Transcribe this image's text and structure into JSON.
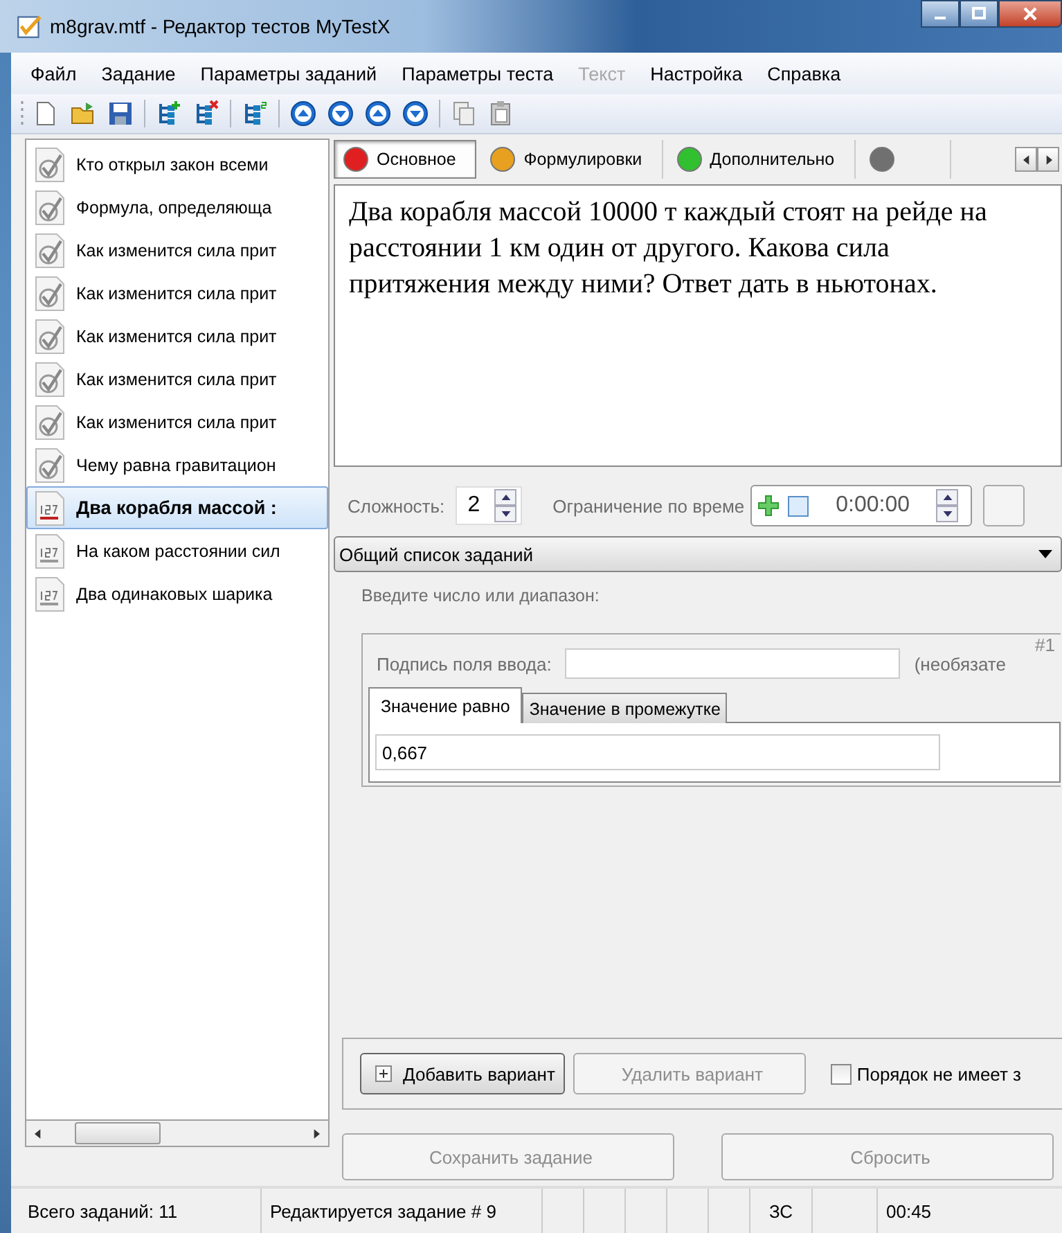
{
  "window": {
    "title": "m8grav.mtf - Редактор тестов MyTestX"
  },
  "menu": [
    {
      "label": "Файл",
      "disabled": false
    },
    {
      "label": "Задание",
      "disabled": false
    },
    {
      "label": "Параметры заданий",
      "disabled": false
    },
    {
      "label": "Параметры теста",
      "disabled": false
    },
    {
      "label": "Текст",
      "disabled": true
    },
    {
      "label": "Настройка",
      "disabled": false
    },
    {
      "label": "Справка",
      "disabled": false
    }
  ],
  "sidebar": {
    "items": [
      {
        "text": "Кто открыл закон всеми",
        "kind": "choice",
        "selected": false
      },
      {
        "text": "Формула, определяюща",
        "kind": "choice",
        "selected": false
      },
      {
        "text": "Как изменится сила прит",
        "kind": "choice",
        "selected": false
      },
      {
        "text": "Как изменится сила прит",
        "kind": "choice",
        "selected": false
      },
      {
        "text": "Как изменится сила прит",
        "kind": "choice",
        "selected": false
      },
      {
        "text": "Как изменится сила прит",
        "kind": "choice",
        "selected": false
      },
      {
        "text": "Как изменится сила прит",
        "kind": "choice",
        "selected": false
      },
      {
        "text": "Чему равна гравитацион",
        "kind": "choice",
        "selected": false
      },
      {
        "text": "Два корабля массой :",
        "kind": "number",
        "selected": true
      },
      {
        "text": "На каком расстоянии сил",
        "kind": "number",
        "selected": false
      },
      {
        "text": "Два одинаковых шарика",
        "kind": "number",
        "selected": false
      }
    ]
  },
  "tabs": [
    {
      "label": "Основное",
      "color": "#e02020",
      "selected": true
    },
    {
      "label": "Формулировки",
      "color": "#e8a020",
      "selected": false
    },
    {
      "label": "Дополнительно",
      "color": "#30c030",
      "selected": false
    },
    {
      "color": "#707070",
      "selected": false
    }
  ],
  "question": "Два корабля массой 10000 т каждый стоят на рейде на расстоянии 1 км один от другого. Какова сила притяжения между ними? Ответ дать в ньютонах.",
  "difficulty": {
    "label": "Сложность:",
    "value": "2"
  },
  "time_limit": {
    "label": "Ограничение по време",
    "checked": false,
    "value": "0:00:00"
  },
  "task_list": {
    "value": "Общий список заданий"
  },
  "prompt": "Введите число или диапазон:",
  "variant": {
    "index": "#1",
    "caption_label": "Подпись поля ввода:",
    "caption_note": "(необязате",
    "answer_tabs": [
      {
        "label": "Значение равно",
        "selected": true
      },
      {
        "label": "Значение в промежутке",
        "selected": false
      }
    ],
    "answer": "0,667"
  },
  "add_button": {
    "label": "Добавить вариант",
    "disabled": false
  },
  "delete_button": {
    "label": "Удалить вариант",
    "disabled": true
  },
  "order_checkbox": {
    "label": "Порядок не имеет з",
    "checked": false
  },
  "save_button": {
    "label": "Сохранить задание",
    "disabled": true
  },
  "reset_button": {
    "label": "Сбросить",
    "disabled": true
  },
  "status_bar": {
    "total": "Всего заданий: 11",
    "editing": "Редактируется задание # 9",
    "mode": "ЗС",
    "time": "00:45"
  }
}
